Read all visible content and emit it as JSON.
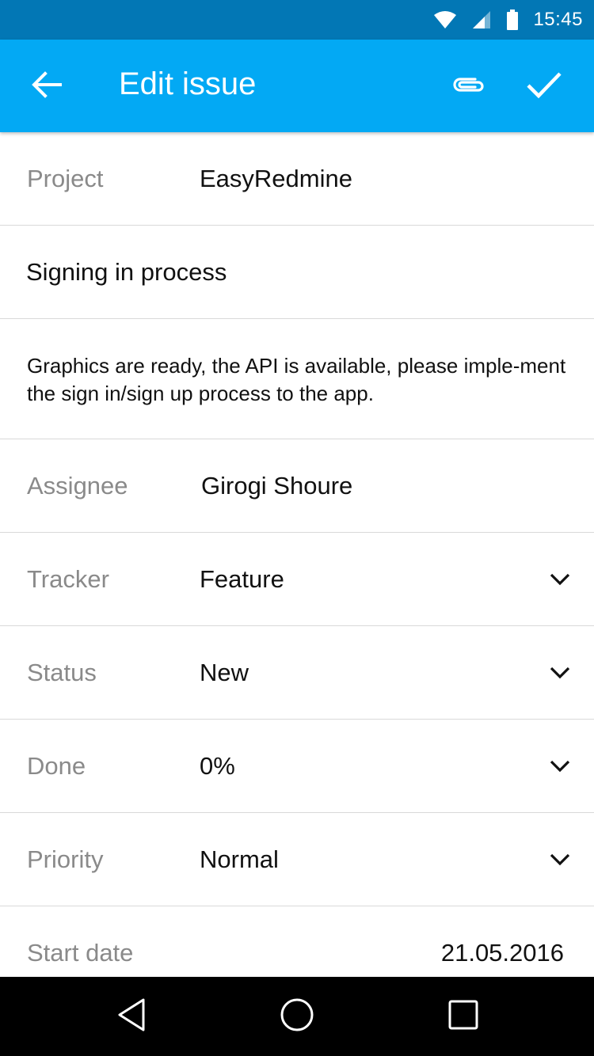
{
  "status_bar": {
    "time": "15:45",
    "icons": [
      "wifi-icon",
      "signal-icon",
      "battery-icon"
    ]
  },
  "app_bar": {
    "title": "Edit issue",
    "nav_icon": "arrow-back-icon",
    "actions": [
      "paperclip-icon",
      "check-icon"
    ]
  },
  "form": {
    "project": {
      "label": "Project",
      "value": "EasyRedmine"
    },
    "subject": "Signing in process",
    "description": "Graphics are ready, the API is available, please imple-ment the sign in/sign up process to the app.",
    "assignee": {
      "label": "Assignee",
      "value": "Girogi Shoure"
    },
    "tracker": {
      "label": "Tracker",
      "value": "Feature"
    },
    "status": {
      "label": "Status",
      "value": "New"
    },
    "done": {
      "label": "Done",
      "value": "0%"
    },
    "priority": {
      "label": "Priority",
      "value": "Normal"
    },
    "start_date": {
      "label": "Start date",
      "value": "21.05.2016"
    }
  },
  "nav_bar": {
    "icons": [
      "nav-back-icon",
      "nav-home-icon",
      "nav-recents-icon"
    ]
  },
  "colors": {
    "status_bar": "#0277b5",
    "app_bar": "#03a9f4",
    "label": "#8a8a8a",
    "divider": "#d9d9d9"
  }
}
